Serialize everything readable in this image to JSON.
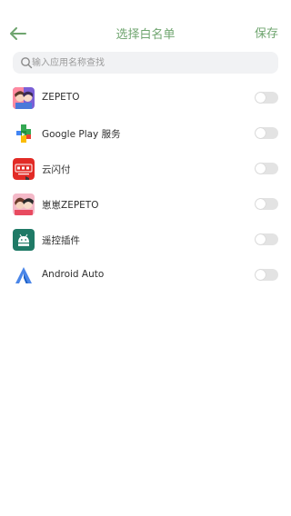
{
  "header": {
    "title": "选择白名单",
    "save_label": "保存",
    "back_icon": "arrow-left-icon"
  },
  "search": {
    "placeholder": "输入应用名称查找",
    "value": "",
    "icon": "search-icon"
  },
  "colors": {
    "accent": "#6fa56f",
    "toggle_off": "#e3e3e3",
    "search_bg": "#f1f2f4"
  },
  "apps": [
    {
      "name": "ZEPETO",
      "icon": "zepeto-app-icon",
      "enabled": false
    },
    {
      "name": "Google Play 服务",
      "icon": "google-play-services-icon",
      "enabled": false
    },
    {
      "name": "云闪付",
      "icon": "unionpay-app-icon",
      "enabled": false
    },
    {
      "name": "崽崽ZEPETO",
      "icon": "zaizai-zepeto-app-icon",
      "enabled": false
    },
    {
      "name": "遥控插件",
      "icon": "android-plugin-icon",
      "enabled": false
    },
    {
      "name": "Android Auto",
      "icon": "android-auto-icon",
      "enabled": false
    }
  ]
}
